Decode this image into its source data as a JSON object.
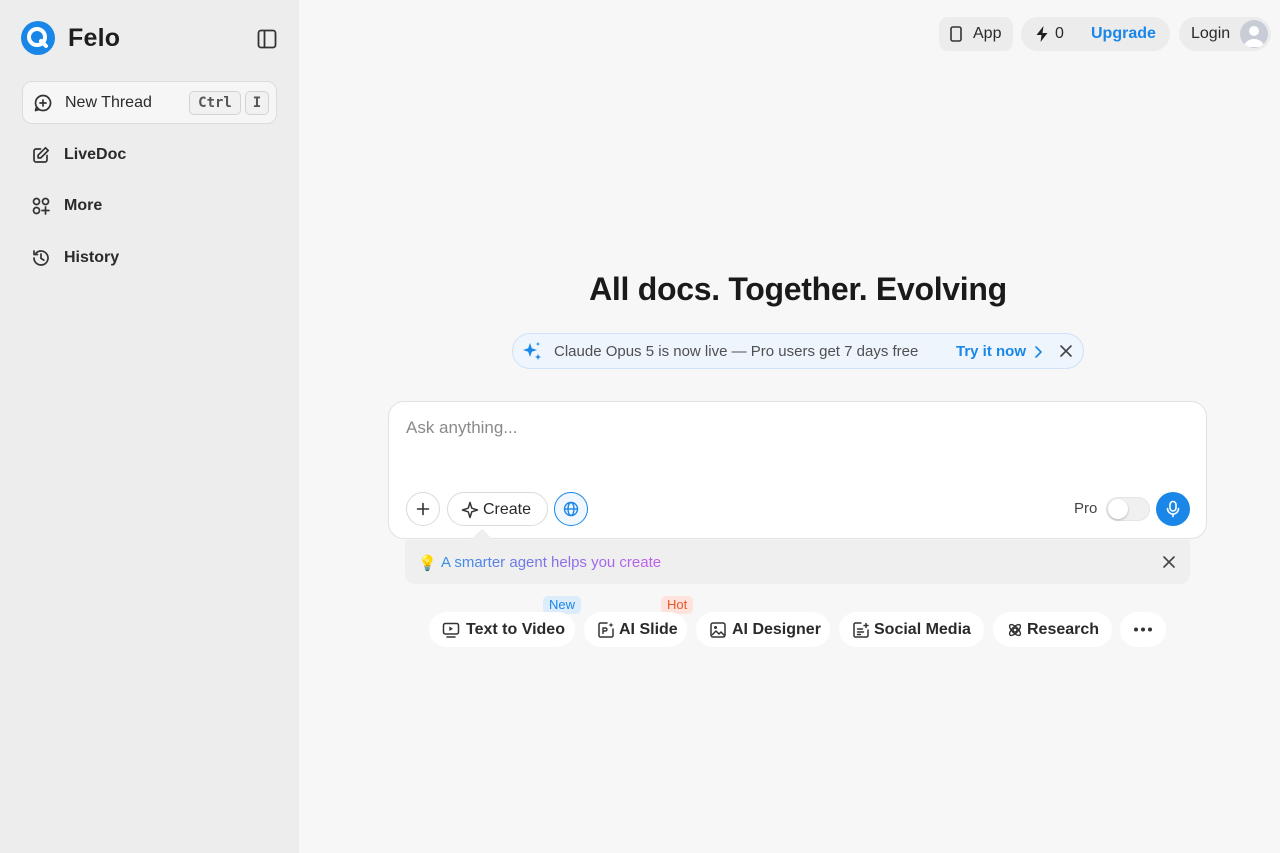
{
  "brand": {
    "name": "Felo",
    "accent": "#1a87e8"
  },
  "sidebar": {
    "new_thread": {
      "label": "New Thread",
      "shortcut_ctrl": "Ctrl",
      "shortcut_key": "I"
    },
    "items": [
      {
        "label": "LiveDoc",
        "icon": "edit-icon"
      },
      {
        "label": "More",
        "icon": "grid-plus-icon"
      },
      {
        "label": "History",
        "icon": "history-icon"
      }
    ]
  },
  "topbar": {
    "app_label": "App",
    "credits_count": "0",
    "upgrade_label": "Upgrade",
    "login_label": "Login"
  },
  "main": {
    "title": "All docs. Together. Evolving",
    "announcement": {
      "text": "Claude Opus 5 is now live — Pro users get 7 days free",
      "link": "Try it now"
    },
    "composer": {
      "placeholder": "Ask anything...",
      "create_label": "Create",
      "pro_label": "Pro",
      "pro_enabled": false
    },
    "tip": {
      "emoji": "💡",
      "text": "A smarter agent helps you create"
    },
    "chips": [
      {
        "label": "Text to Video",
        "icon": "video-icon",
        "badge": "New"
      },
      {
        "label": "AI Slide",
        "icon": "slide-icon",
        "badge": "Hot"
      },
      {
        "label": "AI Designer",
        "icon": "image-icon",
        "badge": ""
      },
      {
        "label": "Social Media",
        "icon": "social-icon",
        "badge": ""
      },
      {
        "label": "Research",
        "icon": "research-icon",
        "badge": ""
      }
    ]
  }
}
